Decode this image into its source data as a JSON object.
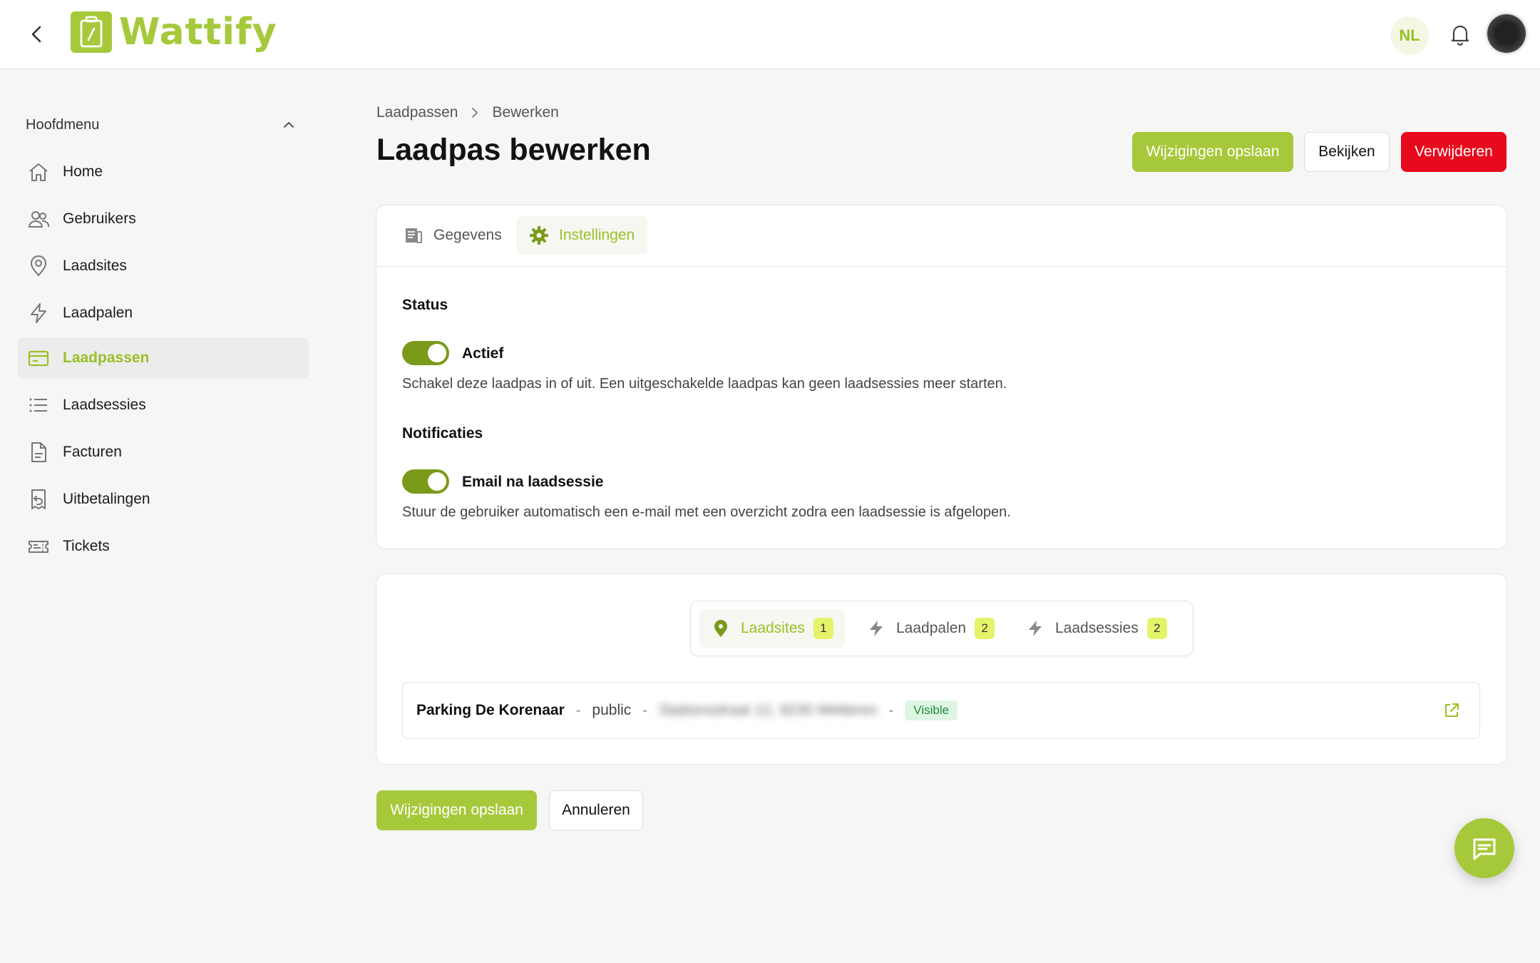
{
  "app": {
    "name": "Wattify",
    "language": "NL"
  },
  "colors": {
    "accent": "#a6c93b",
    "accent_text": "#9bbf26",
    "danger": "#e8091c",
    "toggle_on": "#7a9a1a",
    "badge": "#e5f36b"
  },
  "sidebar": {
    "heading": "Hoofdmenu",
    "items": [
      {
        "label": "Home",
        "icon": "home-icon",
        "active": false
      },
      {
        "label": "Gebruikers",
        "icon": "users-icon",
        "active": false
      },
      {
        "label": "Laadsites",
        "icon": "map-pin-icon",
        "active": false
      },
      {
        "label": "Laadpalen",
        "icon": "bolt-icon",
        "active": false
      },
      {
        "label": "Laadpassen",
        "icon": "card-icon",
        "active": true
      },
      {
        "label": "Laadsessies",
        "icon": "list-icon",
        "active": false
      },
      {
        "label": "Facturen",
        "icon": "document-icon",
        "active": false
      },
      {
        "label": "Uitbetalingen",
        "icon": "receipt-icon",
        "active": false
      },
      {
        "label": "Tickets",
        "icon": "ticket-icon",
        "active": false
      }
    ]
  },
  "breadcrumb": {
    "parent": "Laadpassen",
    "current": "Bewerken"
  },
  "page": {
    "title": "Laadpas bewerken",
    "actions": {
      "save": "Wijzigingen opslaan",
      "view": "Bekijken",
      "delete": "Verwijderen"
    }
  },
  "tabs": [
    {
      "label": "Gegevens",
      "icon": "newspaper-icon",
      "active": false
    },
    {
      "label": "Instellingen",
      "icon": "gear-icon",
      "active": true
    }
  ],
  "settings": {
    "status": {
      "title": "Status",
      "toggle_label": "Actief",
      "enabled": true,
      "help": "Schakel deze laadpas in of uit. Een uitgeschakelde laadpas kan geen laadsessies meer starten."
    },
    "notifications": {
      "title": "Notificaties",
      "toggle_label": "Email na laadsessie",
      "enabled": true,
      "help": "Stuur de gebruiker automatisch een e-mail met een overzicht zodra een laadsessie is afgelopen."
    }
  },
  "related": {
    "tabs": [
      {
        "label": "Laadsites",
        "count": "1",
        "icon": "map-pin-icon",
        "active": true
      },
      {
        "label": "Laadpalen",
        "count": "2",
        "icon": "bolt-icon",
        "active": false
      },
      {
        "label": "Laadsessies",
        "count": "2",
        "icon": "bolt-icon",
        "active": false
      }
    ],
    "row": {
      "name": "Parking De Korenaar",
      "sep": "-",
      "type": "public",
      "address": "Stationsstraat 12, 9230 Wetteren",
      "badge": "Visible"
    }
  },
  "footer": {
    "save": "Wijzigingen opslaan",
    "cancel": "Annuleren"
  }
}
